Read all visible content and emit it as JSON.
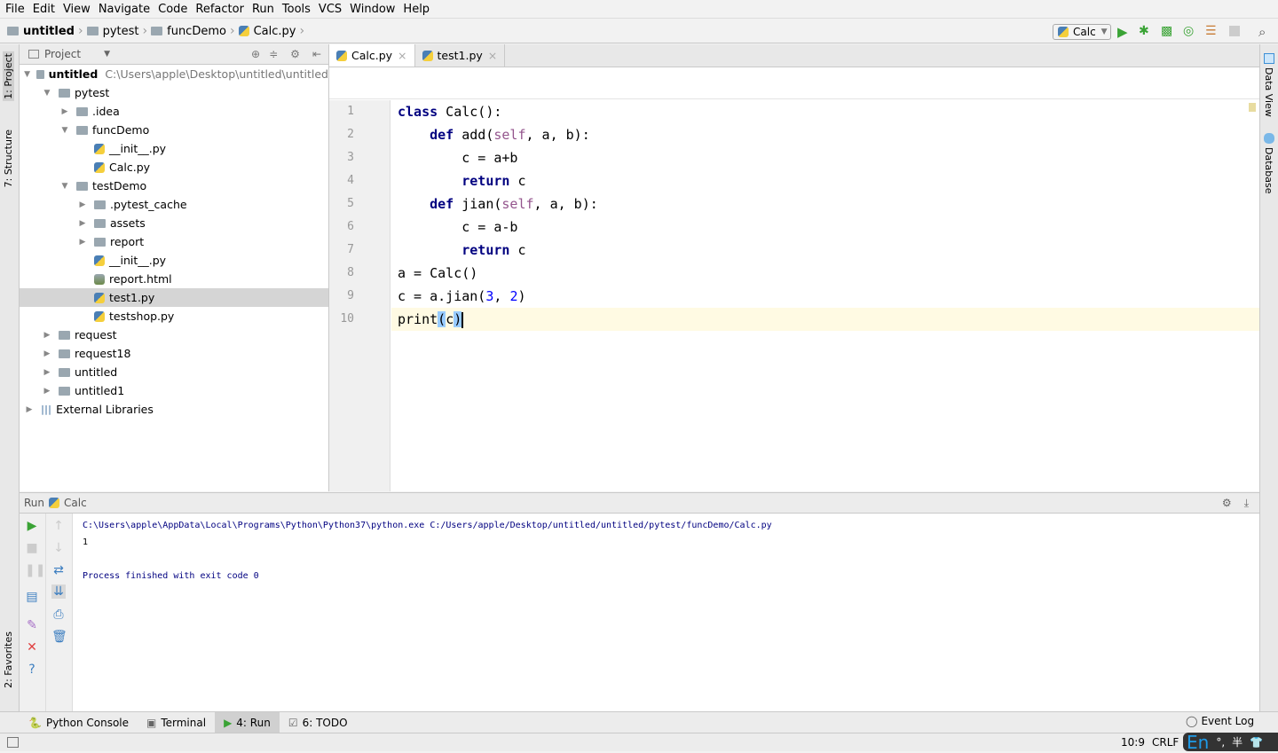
{
  "menu": [
    "File",
    "Edit",
    "View",
    "Navigate",
    "Code",
    "Refactor",
    "Run",
    "Tools",
    "VCS",
    "Window",
    "Help"
  ],
  "breadcrumb": [
    "untitled",
    "pytest",
    "funcDemo",
    "Calc.py"
  ],
  "run_config": "Calc",
  "left_strip": {
    "project": "1: Project",
    "structure": "7: Structure",
    "favorites": "2: Favorites"
  },
  "right_strip": {
    "data_view": "Data View",
    "database": "Database"
  },
  "project": {
    "title": "Project",
    "root_path": "C:\\Users\\apple\\Desktop\\untitled\\untitled",
    "tree": [
      {
        "label": "untitled",
        "depth": 0,
        "arrow": "open",
        "icon": "folder",
        "bold": true
      },
      {
        "label": "pytest",
        "depth": 1,
        "arrow": "open",
        "icon": "folder"
      },
      {
        "label": ".idea",
        "depth": 2,
        "arrow": "closed",
        "icon": "folder"
      },
      {
        "label": "funcDemo",
        "depth": 2,
        "arrow": "open",
        "icon": "folder"
      },
      {
        "label": "__init__.py",
        "depth": 3,
        "arrow": "none",
        "icon": "python"
      },
      {
        "label": "Calc.py",
        "depth": 3,
        "arrow": "none",
        "icon": "python"
      },
      {
        "label": "testDemo",
        "depth": 2,
        "arrow": "open",
        "icon": "folder"
      },
      {
        "label": ".pytest_cache",
        "depth": 3,
        "arrow": "closed",
        "icon": "folder"
      },
      {
        "label": "assets",
        "depth": 3,
        "arrow": "closed",
        "icon": "folder"
      },
      {
        "label": "report",
        "depth": 3,
        "arrow": "closed",
        "icon": "folder"
      },
      {
        "label": "__init__.py",
        "depth": 3,
        "arrow": "none",
        "icon": "python"
      },
      {
        "label": "report.html",
        "depth": 3,
        "arrow": "none",
        "icon": "html"
      },
      {
        "label": "test1.py",
        "depth": 3,
        "arrow": "none",
        "icon": "python",
        "selected": true
      },
      {
        "label": "testshop.py",
        "depth": 3,
        "arrow": "none",
        "icon": "python"
      },
      {
        "label": "request",
        "depth": 1,
        "arrow": "closed",
        "icon": "folder"
      },
      {
        "label": "request18",
        "depth": 1,
        "arrow": "closed",
        "icon": "folder"
      },
      {
        "label": "untitled",
        "depth": 1,
        "arrow": "closed",
        "icon": "folder"
      },
      {
        "label": "untitled1",
        "depth": 1,
        "arrow": "closed",
        "icon": "folder"
      },
      {
        "label": "External Libraries",
        "depth": 0,
        "arrow": "closed",
        "icon": "library"
      }
    ]
  },
  "editor_tabs": [
    {
      "label": "Calc.py",
      "active": true
    },
    {
      "label": "test1.py",
      "active": false
    }
  ],
  "code": [
    [
      [
        "kw",
        "class"
      ],
      [
        "t",
        " Calc():"
      ]
    ],
    [
      [
        "t",
        "    "
      ],
      [
        "kw",
        "def"
      ],
      [
        "t",
        " add("
      ],
      [
        "self",
        "self"
      ],
      [
        "t",
        ", a, b):"
      ]
    ],
    [
      [
        "t",
        "        c = a+b"
      ]
    ],
    [
      [
        "t",
        "        "
      ],
      [
        "kw",
        "return"
      ],
      [
        "t",
        " c"
      ]
    ],
    [
      [
        "t",
        "    "
      ],
      [
        "kw",
        "def"
      ],
      [
        "t",
        " jian("
      ],
      [
        "self",
        "self"
      ],
      [
        "t",
        ", a, b):"
      ]
    ],
    [
      [
        "t",
        "        c = a-b"
      ]
    ],
    [
      [
        "t",
        "        "
      ],
      [
        "kw",
        "return"
      ],
      [
        "t",
        " c"
      ]
    ],
    [
      [
        "t",
        "a = Calc()"
      ]
    ],
    [
      [
        "t",
        "c = a.jian("
      ],
      [
        "num",
        "3"
      ],
      [
        "t",
        ", "
      ],
      [
        "num",
        "2"
      ],
      [
        "t",
        ")"
      ]
    ],
    [
      [
        "t",
        "print"
      ],
      [
        "brace",
        "("
      ],
      [
        "t",
        "c"
      ],
      [
        "brace",
        ")"
      ]
    ]
  ],
  "current_line": 10,
  "run": {
    "label": "Run",
    "config": "Calc",
    "output": [
      "C:\\Users\\apple\\AppData\\Local\\Programs\\Python\\Python37\\python.exe C:/Users/apple/Desktop/untitled/untitled/pytest/funcDemo/Calc.py",
      "1",
      "",
      "Process finished with exit code 0"
    ]
  },
  "bottom_tabs": [
    {
      "label": "Python Console"
    },
    {
      "label": "Terminal"
    },
    {
      "label": "4: Run",
      "active": true
    },
    {
      "label": "6: TODO"
    }
  ],
  "event_log": "Event Log",
  "status": {
    "position": "10:9",
    "line_ending": "CRLF"
  },
  "ime": {
    "lang": "En",
    "punct": "°,",
    "width": "半"
  },
  "colors": {
    "keyword": "#000080",
    "self": "#94558d",
    "number": "#0000ff",
    "run_green": "#3aa335"
  }
}
